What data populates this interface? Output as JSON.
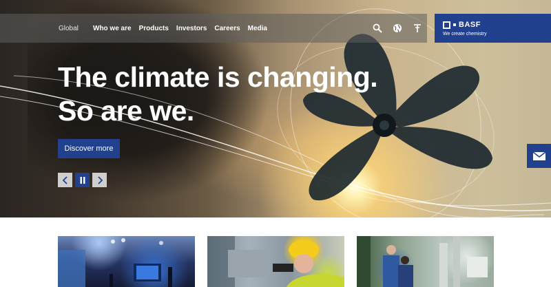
{
  "nav": {
    "global_label": "Global",
    "links": [
      {
        "label": "Who we are"
      },
      {
        "label": "Products"
      },
      {
        "label": "Investors"
      },
      {
        "label": "Careers"
      },
      {
        "label": "Media"
      }
    ],
    "icons": [
      "search-icon",
      "globe-icon",
      "bookmark-icon"
    ]
  },
  "brand": {
    "logo_text": "BASF",
    "tagline": "We create chemistry",
    "color": "#21418f"
  },
  "hero": {
    "headline_line1": "The climate is changing.",
    "headline_line2": "So are we.",
    "cta_label": "Discover more",
    "controls": [
      "prev-icon",
      "pause-icon",
      "next-icon"
    ]
  },
  "contact": {
    "icon": "mail-icon"
  },
  "cards": [
    {
      "image": "conference-stage-image"
    },
    {
      "image": "worker-hardhat-image"
    },
    {
      "image": "lab-technicians-image"
    }
  ]
}
